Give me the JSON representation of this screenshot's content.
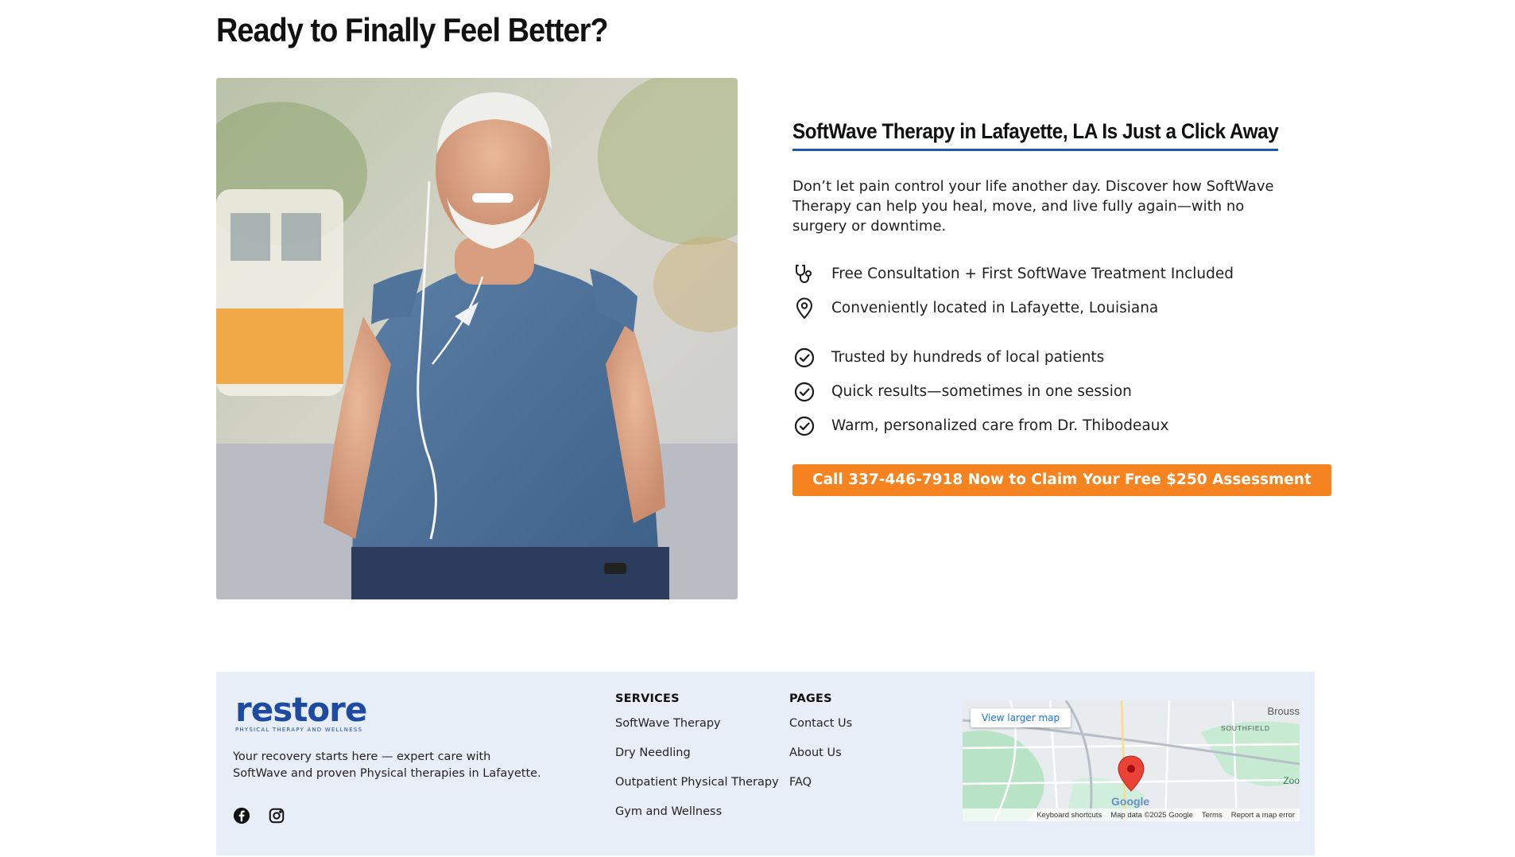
{
  "page": {
    "title": "Ready to Finally Feel Better?"
  },
  "hero": {
    "image_alt": "Smiling older man in blue t-shirt walking outdoors with earphones"
  },
  "offer": {
    "title": "SoftWave Therapy in Lafayette, LA Is Just a Click Away",
    "description": "Don’t let pain control your life another day. Discover how SoftWave Therapy can help you heal, move, and live fully again—with no surgery or downtime.",
    "features": [
      {
        "icon": "stethoscope-icon",
        "text": "Free Consultation + First SoftWave Treatment Included"
      },
      {
        "icon": "location-pin-icon",
        "text": "Conveniently located in Lafayette, Louisiana"
      },
      {
        "icon": "check-circle-icon",
        "text": "Trusted by hundreds of local patients"
      },
      {
        "icon": "check-circle-icon",
        "text": "Quick results—sometimes in one session"
      },
      {
        "icon": "check-circle-icon",
        "text": "Warm, personalized care from Dr. Thibodeaux"
      }
    ],
    "cta_label": "Call 337-446-7918 Now to Claim Your Free $250 Assessment",
    "accent_color": "#f5831f",
    "underline_color": "#1e5aa8"
  },
  "footer": {
    "logo_text": "restore",
    "logo_subtext": "PHYSICAL THERAPY AND WELLNESS",
    "brand_color": "#1e4aa0",
    "tagline": "Your recovery starts here — expert care with SoftWave and proven Physical therapies in Lafayette.",
    "socials": [
      "facebook-icon",
      "instagram-icon"
    ],
    "services": {
      "heading": "SERVICES",
      "links": [
        "SoftWave Therapy",
        "Dry Needling",
        "Outpatient Physical Therapy",
        "Gym and Wellness"
      ]
    },
    "pages": {
      "heading": "PAGES",
      "links": [
        "Contact Us",
        "About Us",
        "FAQ"
      ]
    },
    "map": {
      "view_larger": "View larger map",
      "label_city": "Brouss",
      "label_area": "SOUTHFIELD",
      "label_zoo": "Zoo",
      "google": "Google",
      "footer_items": [
        "Keyboard shortcuts",
        "Map data ©2025 Google",
        "Terms",
        "Report a map error"
      ]
    }
  }
}
